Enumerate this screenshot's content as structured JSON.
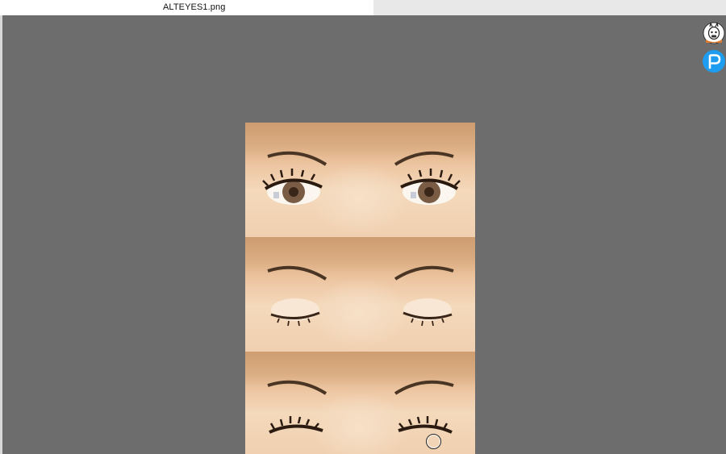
{
  "window": {
    "tab_title": "ALTEYES1.png"
  },
  "image": {
    "frames": [
      {
        "state": "eyes-open"
      },
      {
        "state": "eyes-closed"
      },
      {
        "state": "eyes-closed-lashes"
      }
    ]
  },
  "extensions": [
    {
      "icon": "llama-extension-icon"
    },
    {
      "icon": "pixiv-extension-icon"
    }
  ],
  "colors": {
    "viewer_background": "#6d6d6d",
    "pixiv_blue": "#1e9cf0",
    "iris": "#7a5c44"
  }
}
